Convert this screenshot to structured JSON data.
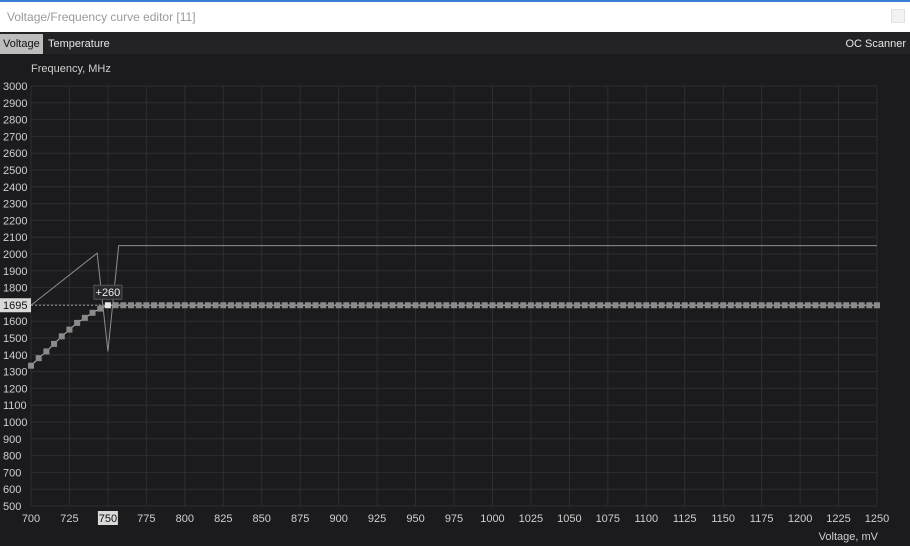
{
  "window": {
    "title": "Voltage/Frequency curve editor [11]"
  },
  "tabs": [
    {
      "label": "Voltage",
      "active": true
    },
    {
      "label": "Temperature",
      "active": false
    }
  ],
  "actions": {
    "oc_scanner_label": "OC Scanner"
  },
  "colors": {
    "background": "#1b1b1e",
    "grid": "#2d2e33",
    "curve": "#bdbdbd",
    "point": "#8a8a8a",
    "highlight": "#e6e6e6"
  },
  "chart_data": {
    "type": "line",
    "ylabel": "Frequency, MHz",
    "xlabel": "Voltage, mV",
    "xlim": [
      700,
      1250
    ],
    "ylim": [
      500,
      3000
    ],
    "x_ticks": [
      700,
      725,
      750,
      775,
      800,
      825,
      850,
      875,
      900,
      925,
      950,
      975,
      1000,
      1025,
      1050,
      1075,
      1100,
      1125,
      1150,
      1175,
      1200,
      1225,
      1250
    ],
    "y_ticks": [
      500,
      600,
      700,
      800,
      900,
      1000,
      1100,
      1200,
      1300,
      1400,
      1500,
      1600,
      1700,
      1800,
      1900,
      2000,
      2100,
      2200,
      2300,
      2400,
      2500,
      2600,
      2700,
      2800,
      2900,
      3000
    ],
    "highlight_x_tick": 750,
    "highlight_y_value": 1695,
    "highlight_y_label": "1695",
    "selected_point": {
      "x": 750,
      "y": 1695,
      "label": "+260"
    },
    "series": [
      {
        "points": [
          [
            700,
            1695
          ],
          [
            743,
            2005
          ],
          [
            750,
            1420
          ],
          [
            757,
            2050
          ],
          [
            1250,
            2050
          ]
        ]
      },
      {
        "points": [
          [
            700,
            1335
          ],
          [
            705,
            1380
          ],
          [
            710,
            1420
          ],
          [
            715,
            1465
          ],
          [
            720,
            1510
          ],
          [
            725,
            1550
          ],
          [
            730,
            1590
          ],
          [
            735,
            1620
          ],
          [
            740,
            1650
          ],
          [
            745,
            1675
          ],
          [
            750,
            1695
          ],
          [
            755,
            1695
          ],
          [
            760,
            1695
          ],
          [
            765,
            1695
          ],
          [
            770,
            1695
          ],
          [
            775,
            1695
          ],
          [
            780,
            1695
          ],
          [
            785,
            1695
          ],
          [
            790,
            1695
          ],
          [
            795,
            1695
          ],
          [
            800,
            1695
          ],
          [
            805,
            1695
          ],
          [
            810,
            1695
          ],
          [
            815,
            1695
          ],
          [
            820,
            1695
          ],
          [
            825,
            1695
          ],
          [
            830,
            1695
          ],
          [
            835,
            1695
          ],
          [
            840,
            1695
          ],
          [
            845,
            1695
          ],
          [
            850,
            1695
          ],
          [
            855,
            1695
          ],
          [
            860,
            1695
          ],
          [
            865,
            1695
          ],
          [
            870,
            1695
          ],
          [
            875,
            1695
          ],
          [
            880,
            1695
          ],
          [
            885,
            1695
          ],
          [
            890,
            1695
          ],
          [
            895,
            1695
          ],
          [
            900,
            1695
          ],
          [
            905,
            1695
          ],
          [
            910,
            1695
          ],
          [
            915,
            1695
          ],
          [
            920,
            1695
          ],
          [
            925,
            1695
          ],
          [
            930,
            1695
          ],
          [
            935,
            1695
          ],
          [
            940,
            1695
          ],
          [
            945,
            1695
          ],
          [
            950,
            1695
          ],
          [
            955,
            1695
          ],
          [
            960,
            1695
          ],
          [
            965,
            1695
          ],
          [
            970,
            1695
          ],
          [
            975,
            1695
          ],
          [
            980,
            1695
          ],
          [
            985,
            1695
          ],
          [
            990,
            1695
          ],
          [
            995,
            1695
          ],
          [
            1000,
            1695
          ],
          [
            1005,
            1695
          ],
          [
            1010,
            1695
          ],
          [
            1015,
            1695
          ],
          [
            1020,
            1695
          ],
          [
            1025,
            1695
          ],
          [
            1030,
            1695
          ],
          [
            1035,
            1695
          ],
          [
            1040,
            1695
          ],
          [
            1045,
            1695
          ],
          [
            1050,
            1695
          ],
          [
            1055,
            1695
          ],
          [
            1060,
            1695
          ],
          [
            1065,
            1695
          ],
          [
            1070,
            1695
          ],
          [
            1075,
            1695
          ],
          [
            1080,
            1695
          ],
          [
            1085,
            1695
          ],
          [
            1090,
            1695
          ],
          [
            1095,
            1695
          ],
          [
            1100,
            1695
          ],
          [
            1105,
            1695
          ],
          [
            1110,
            1695
          ],
          [
            1115,
            1695
          ],
          [
            1120,
            1695
          ],
          [
            1125,
            1695
          ],
          [
            1130,
            1695
          ],
          [
            1135,
            1695
          ],
          [
            1140,
            1695
          ],
          [
            1145,
            1695
          ],
          [
            1150,
            1695
          ],
          [
            1155,
            1695
          ],
          [
            1160,
            1695
          ],
          [
            1165,
            1695
          ],
          [
            1170,
            1695
          ],
          [
            1175,
            1695
          ],
          [
            1180,
            1695
          ],
          [
            1185,
            1695
          ],
          [
            1190,
            1695
          ],
          [
            1195,
            1695
          ],
          [
            1200,
            1695
          ],
          [
            1205,
            1695
          ],
          [
            1210,
            1695
          ],
          [
            1215,
            1695
          ],
          [
            1220,
            1695
          ],
          [
            1225,
            1695
          ],
          [
            1230,
            1695
          ],
          [
            1235,
            1695
          ],
          [
            1240,
            1695
          ],
          [
            1245,
            1695
          ],
          [
            1250,
            1695
          ]
        ]
      }
    ]
  }
}
